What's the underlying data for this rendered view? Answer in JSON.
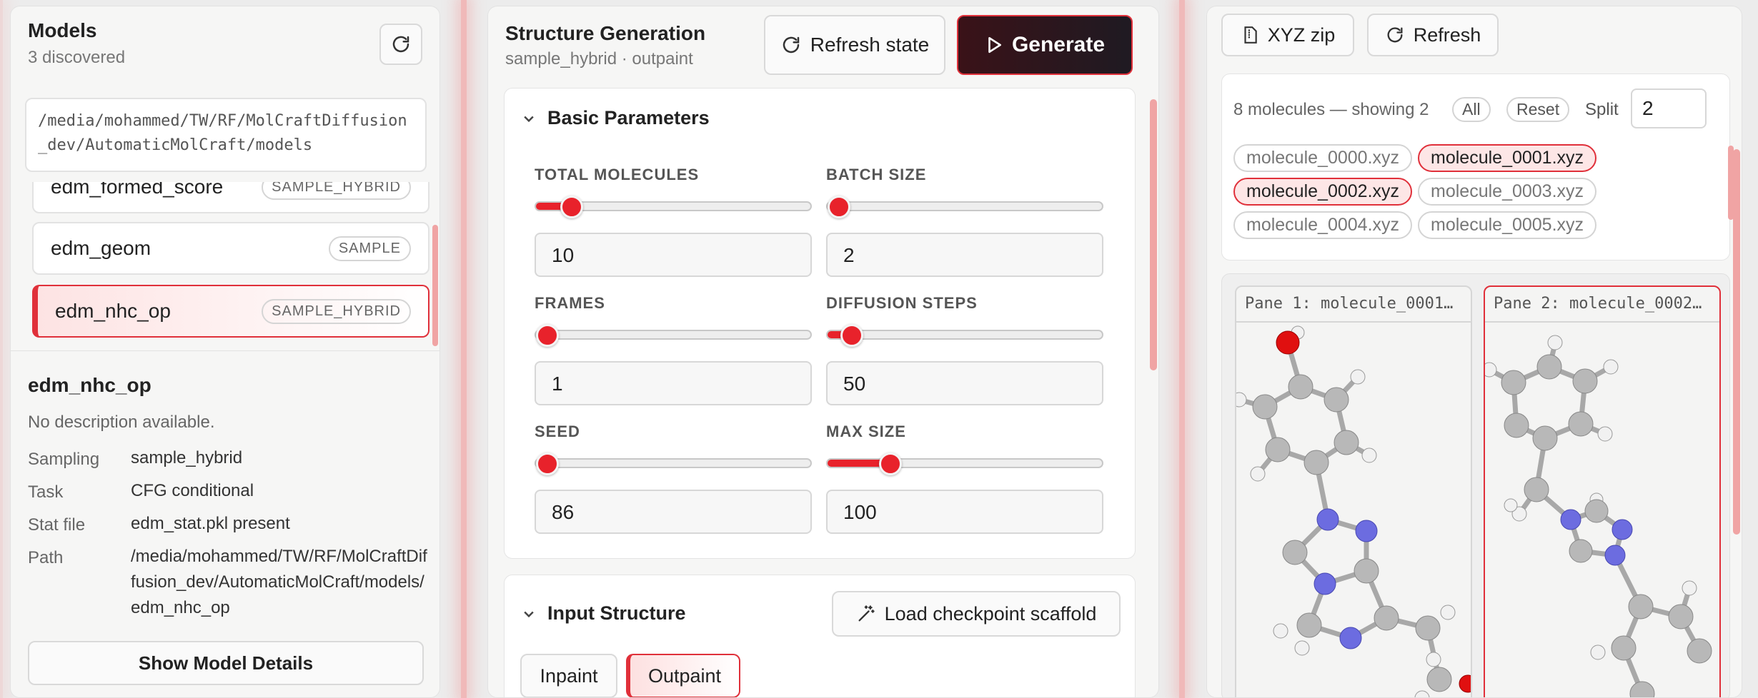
{
  "models_panel": {
    "title": "Models",
    "subtitle": "3 discovered",
    "path": "/media/mohammed/TW/RF/MolCraftDiffusion_dev/AutomaticMolCraft/models",
    "items": [
      {
        "name": "edm_formed_score",
        "badge": "SAMPLE_HYBRID"
      },
      {
        "name": "edm_geom",
        "badge": "SAMPLE"
      },
      {
        "name": "edm_nhc_op",
        "badge": "SAMPLE_HYBRID"
      }
    ],
    "selected": {
      "name": "edm_nhc_op",
      "description": "No description available.",
      "sampling_label": "Sampling",
      "sampling": "sample_hybrid",
      "task_label": "Task",
      "task": "CFG conditional",
      "stat_label": "Stat file",
      "stat": "edm_stat.pkl present",
      "path_label": "Path",
      "path": "/media/mohammed/TW/RF/MolCraftDiffusion_dev/AutomaticMolCraft/models/edm_nhc_op"
    },
    "details_button": "Show Model Details"
  },
  "generation": {
    "title": "Structure Generation",
    "subtitle": "sample_hybrid · outpaint",
    "refresh_button": "Refresh state",
    "generate_button": "Generate",
    "basic_section": "Basic Parameters",
    "params": {
      "total_molecules": {
        "label": "TOTAL MOLECULES",
        "value": "10",
        "fraction": 0.06
      },
      "batch_size": {
        "label": "BATCH SIZE",
        "value": "2",
        "fraction": 0.01
      },
      "frames": {
        "label": "FRAMES",
        "value": "1",
        "fraction": 0.0
      },
      "diffusion_steps": {
        "label": "DIFFUSION STEPS",
        "value": "50",
        "fraction": 0.05
      },
      "seed": {
        "label": "SEED",
        "value": "86",
        "fraction": 0.0
      },
      "max_size": {
        "label": "MAX SIZE",
        "value": "100",
        "fraction": 0.22
      }
    },
    "input_section": "Input Structure",
    "load_button": "Load checkpoint scaffold",
    "mode_inpaint": "Inpaint",
    "mode_outpaint": "Outpaint"
  },
  "viewer": {
    "xyz_button": "XYZ zip",
    "refresh_button": "Refresh",
    "summary": "8 molecules — showing 2",
    "all_button": "All",
    "reset_button": "Reset",
    "split_label": "Split",
    "split_value": "2",
    "files": [
      {
        "name": "molecule_0000.xyz",
        "selected": false
      },
      {
        "name": "molecule_0001.xyz",
        "selected": true
      },
      {
        "name": "molecule_0002.xyz",
        "selected": true
      },
      {
        "name": "molecule_0003.xyz",
        "selected": false
      },
      {
        "name": "molecule_0004.xyz",
        "selected": false
      },
      {
        "name": "molecule_0005.xyz",
        "selected": false
      }
    ],
    "pane1_title": "Pane 1: molecule_0001…",
    "pane2_title": "Pane 2: molecule_0002…"
  },
  "colors": {
    "accent": "#e8222b",
    "generate_bg": "#2a1a1f",
    "nitrogen": "#6c6ce0",
    "oxygen": "#e01010",
    "carbon": "#b8b8b8"
  },
  "icons": {
    "refresh": "refresh-icon",
    "generate": "play-icon",
    "zip": "file-zip-icon",
    "wand": "magic-wand-icon",
    "chevron": "chevron-down-icon"
  }
}
